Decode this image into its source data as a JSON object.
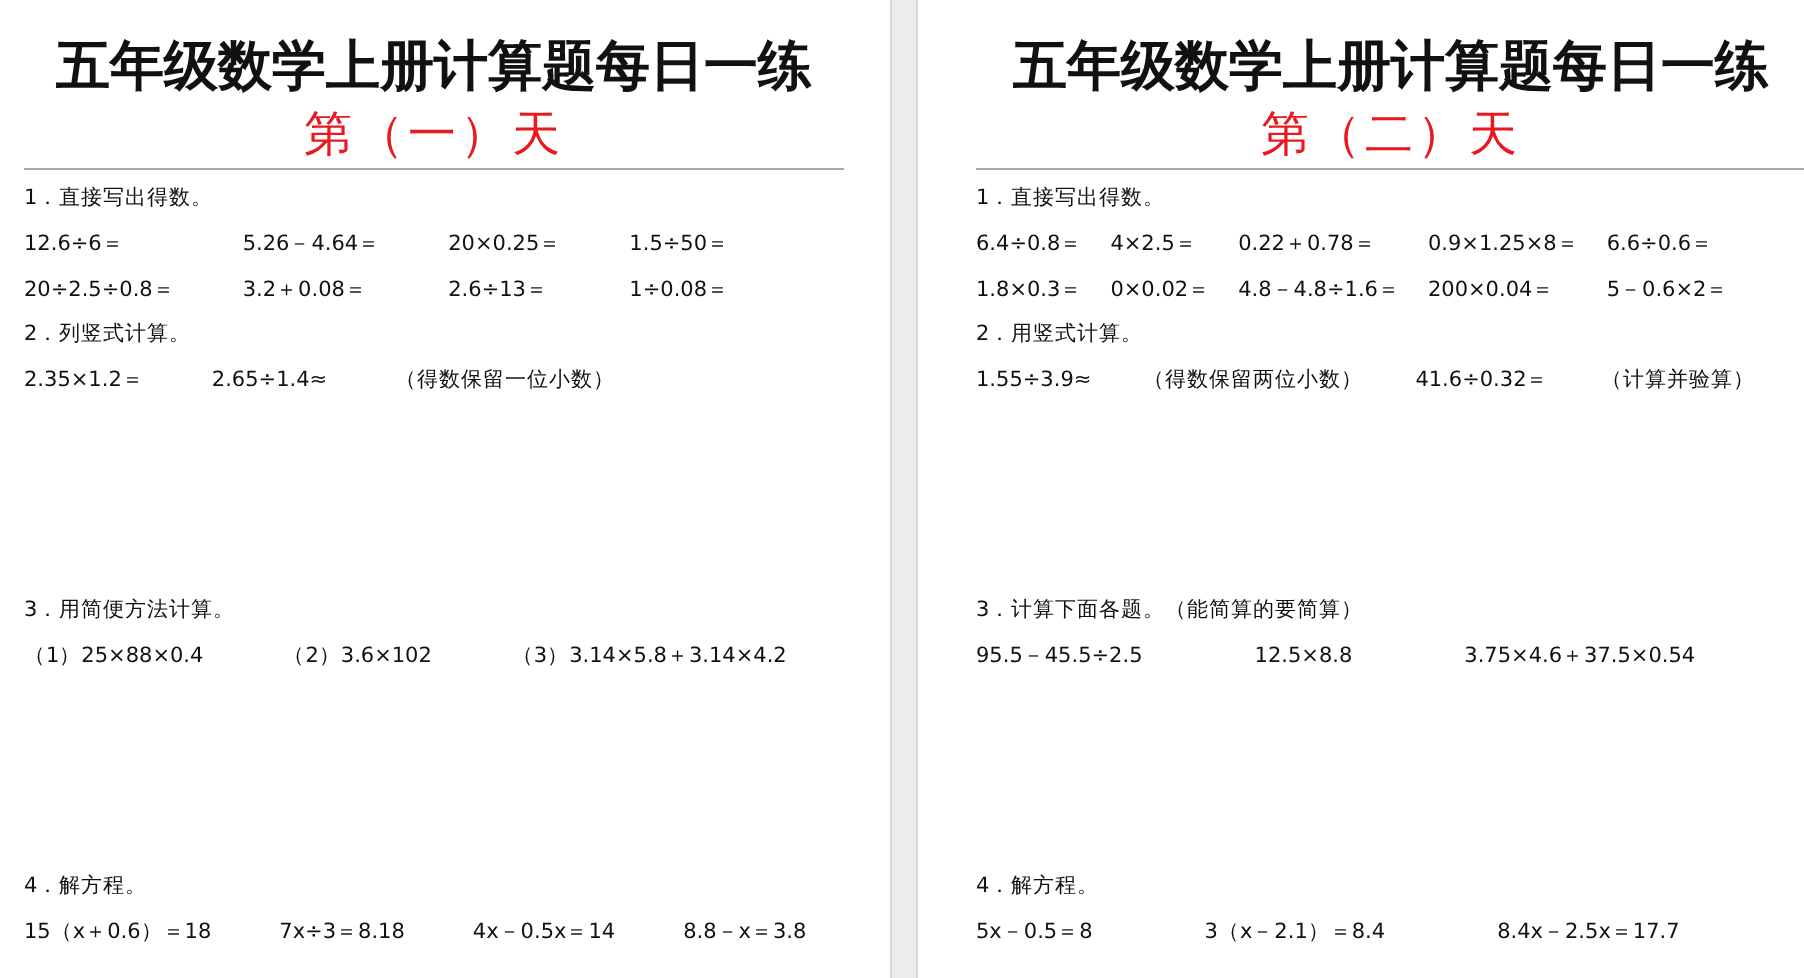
{
  "pages": [
    {
      "title": "五年级数学上册计算题每日一练",
      "day": "第（一）天",
      "sections": [
        {
          "heading": "1．直接写出得数。",
          "rows": [
            [
              "12.6÷6＝",
              "5.26－4.64＝",
              "20×0.25＝",
              "1.5÷50＝"
            ],
            [
              "20÷2.5÷0.8＝",
              "3.2＋0.08＝",
              "2.6÷13＝",
              "1÷0.08＝"
            ]
          ]
        },
        {
          "heading": "2．列竖式计算。",
          "rows": [
            [
              "2.35×1.2＝",
              "2.65÷1.4≈",
              "（得数保留一位小数）"
            ]
          ]
        },
        {
          "heading": "3．用简便方法计算。",
          "rows": [
            [
              "（1）25×88×0.4",
              "（2）3.6×102",
              "（3）3.14×5.8＋3.14×4.2"
            ]
          ]
        },
        {
          "heading": "4．解方程。",
          "rows": [
            [
              "15（x＋0.6）＝18",
              "7x÷3＝8.18",
              "4x－0.5x＝14",
              "8.8－x＝3.8"
            ]
          ]
        }
      ]
    },
    {
      "title": "五年级数学上册计算题每日一练",
      "day": "第（二）天",
      "sections": [
        {
          "heading": "1．直接写出得数。",
          "rows": [
            [
              "6.4÷0.8＝",
              "4×2.5＝",
              "0.22＋0.78＝",
              "0.9×1.25×8＝",
              "6.6÷0.6＝"
            ],
            [
              "1.8×0.3＝",
              "0×0.02＝",
              "4.8－4.8÷1.6＝",
              "200×0.04＝",
              "5－0.6×2＝"
            ]
          ]
        },
        {
          "heading": "2．用竖式计算。",
          "rows": [
            [
              "1.55÷3.9≈",
              "（得数保留两位小数）",
              "41.6÷0.32＝",
              "（计算并验算）"
            ]
          ]
        },
        {
          "heading": "3．计算下面各题。（能简算的要简算）",
          "rows": [
            [
              "95.5－45.5÷2.5",
              "12.5×8.8",
              "3.75×4.6＋37.5×0.54"
            ]
          ]
        },
        {
          "heading": "4．解方程。",
          "rows": [
            [
              "5x－0.5＝8",
              "3（x－2.1）＝8.4",
              "8.4x－2.5x＝17.7"
            ]
          ]
        }
      ]
    }
  ]
}
